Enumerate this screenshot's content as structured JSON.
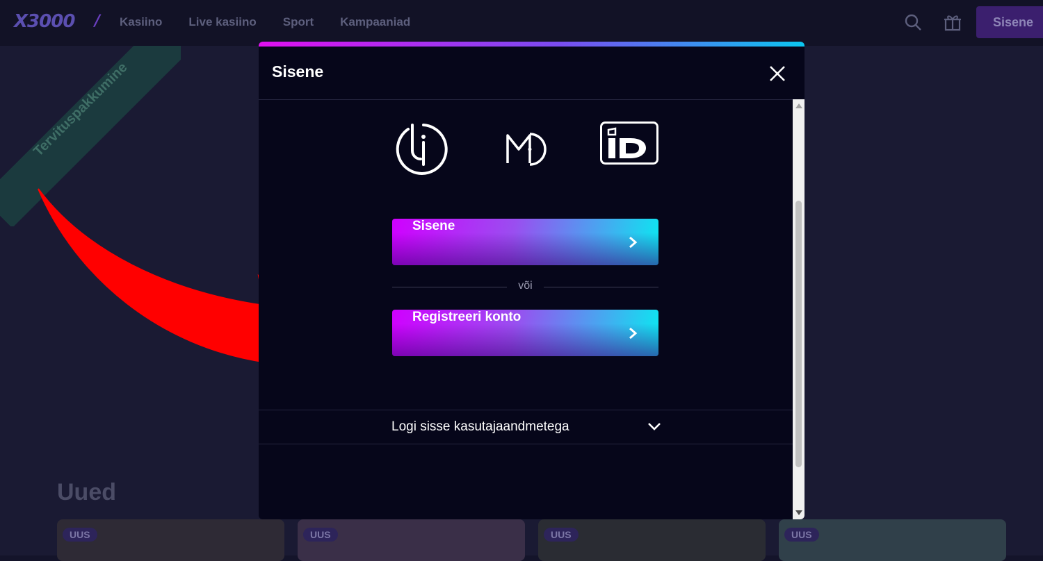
{
  "header": {
    "logo": "X3000",
    "nav": [
      "Kasiino",
      "Live kasiino",
      "Sport",
      "Kampaaniad"
    ],
    "login_label": "Sisene"
  },
  "background": {
    "ribbon": "Tervituspakkumine",
    "section_title": "Uued",
    "card_badge": "UUS"
  },
  "modal": {
    "title": "Sisene",
    "id_methods": [
      "smart-id-icon",
      "mobile-id-icon",
      "id-card-icon"
    ],
    "login_button": "Sisene",
    "or_text": "või",
    "register_button": "Registreeri konto",
    "credentials_toggle": "Logi sisse kasutajaandmetega"
  },
  "colors": {
    "accent_gradient": [
      "#d000ff",
      "#9a4ef0",
      "#0be8f0"
    ],
    "modal_bg": "#06061a",
    "page_bg": "#1a1a33",
    "arrow": "#ff0000"
  }
}
